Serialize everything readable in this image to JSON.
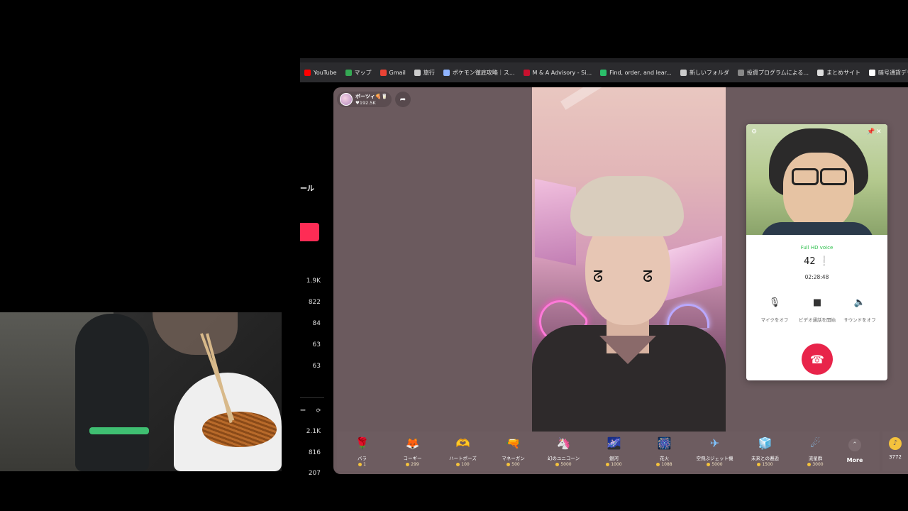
{
  "bookmarks": [
    {
      "label": "YouTube",
      "icon": "youtube-icon",
      "color": "#ff0000"
    },
    {
      "label": "マップ",
      "icon": "maps-pin-icon",
      "color": "#34a853"
    },
    {
      "label": "Gmail",
      "icon": "gmail-icon",
      "color": "#ea4335"
    },
    {
      "label": "旅行",
      "icon": "folder-icon",
      "color": "#cccccc"
    },
    {
      "label": "ポケモン徹底攻略｜ス...",
      "icon": "pokemon-site-icon",
      "color": "#8fb4ff"
    },
    {
      "label": "M & A Advisory - Si...",
      "icon": "ma-advisory-icon",
      "color": "#c8102e"
    },
    {
      "label": "Find, order, and lear...",
      "icon": "find-order-icon",
      "color": "#2bbf6a"
    },
    {
      "label": "新しいフォルダ",
      "icon": "folder-icon",
      "color": "#cccccc"
    },
    {
      "label": "投資プログラムによる...",
      "icon": "invest-icon",
      "color": "#888888"
    },
    {
      "label": "まとめサイト",
      "icon": "globe-icon",
      "color": "#dddddd"
    },
    {
      "label": "暗号通貨デリバティブ...",
      "icon": "crypto-icon",
      "color": "#ffffff"
    }
  ],
  "left_sidebar": {
    "label_partial": "ール",
    "stats_top": [
      "1.9K",
      "822",
      "84",
      "63",
      "63"
    ],
    "label2_partial": "ー",
    "stats_bottom": [
      "2.1K",
      "816",
      "207"
    ]
  },
  "host": {
    "name": "ボーツィ🍕🥛",
    "likes": "♥192.5K"
  },
  "call": {
    "quality": "Full HD voice",
    "callee": "42 ❕",
    "timer": "02:28:48",
    "controls": [
      {
        "label": "マイクをオフ",
        "icon": "microphone-icon",
        "glyph": "🎙"
      },
      {
        "label": "ビデオ通話を開始",
        "icon": "video-camera-icon",
        "glyph": "■"
      },
      {
        "label": "サウンドをオフ",
        "icon": "speaker-icon",
        "glyph": "🔈"
      }
    ]
  },
  "gifts": [
    {
      "name": "バラ",
      "price": "1",
      "glyph": "🌹",
      "color": "#e23a55"
    },
    {
      "name": "コーギー",
      "price": "299",
      "glyph": "🦊",
      "color": "#f0a060"
    },
    {
      "name": "ハートポーズ",
      "price": "100",
      "glyph": "🫶",
      "color": "#f2a7c5"
    },
    {
      "name": "マネーガン",
      "price": "500",
      "glyph": "🔫",
      "color": "#f59ad0"
    },
    {
      "name": "幻のユニコーン",
      "price": "5000",
      "glyph": "🦄",
      "color": "#c9b8ff"
    },
    {
      "name": "銀河",
      "price": "1000",
      "glyph": "🌌",
      "color": "#6ab2ff"
    },
    {
      "name": "花火",
      "price": "1088",
      "glyph": "🎆",
      "color": "#9ecbff"
    },
    {
      "name": "空飛ぶジェット機",
      "price": "5000",
      "glyph": "✈",
      "color": "#7fc4ff"
    },
    {
      "name": "未来との邂逅",
      "price": "1500",
      "glyph": "🧊",
      "color": "#4aa0ff"
    },
    {
      "name": "流星群",
      "price": "3000",
      "glyph": "☄",
      "color": "#8fd0ff"
    }
  ],
  "more_label": "More",
  "balance": "3772"
}
